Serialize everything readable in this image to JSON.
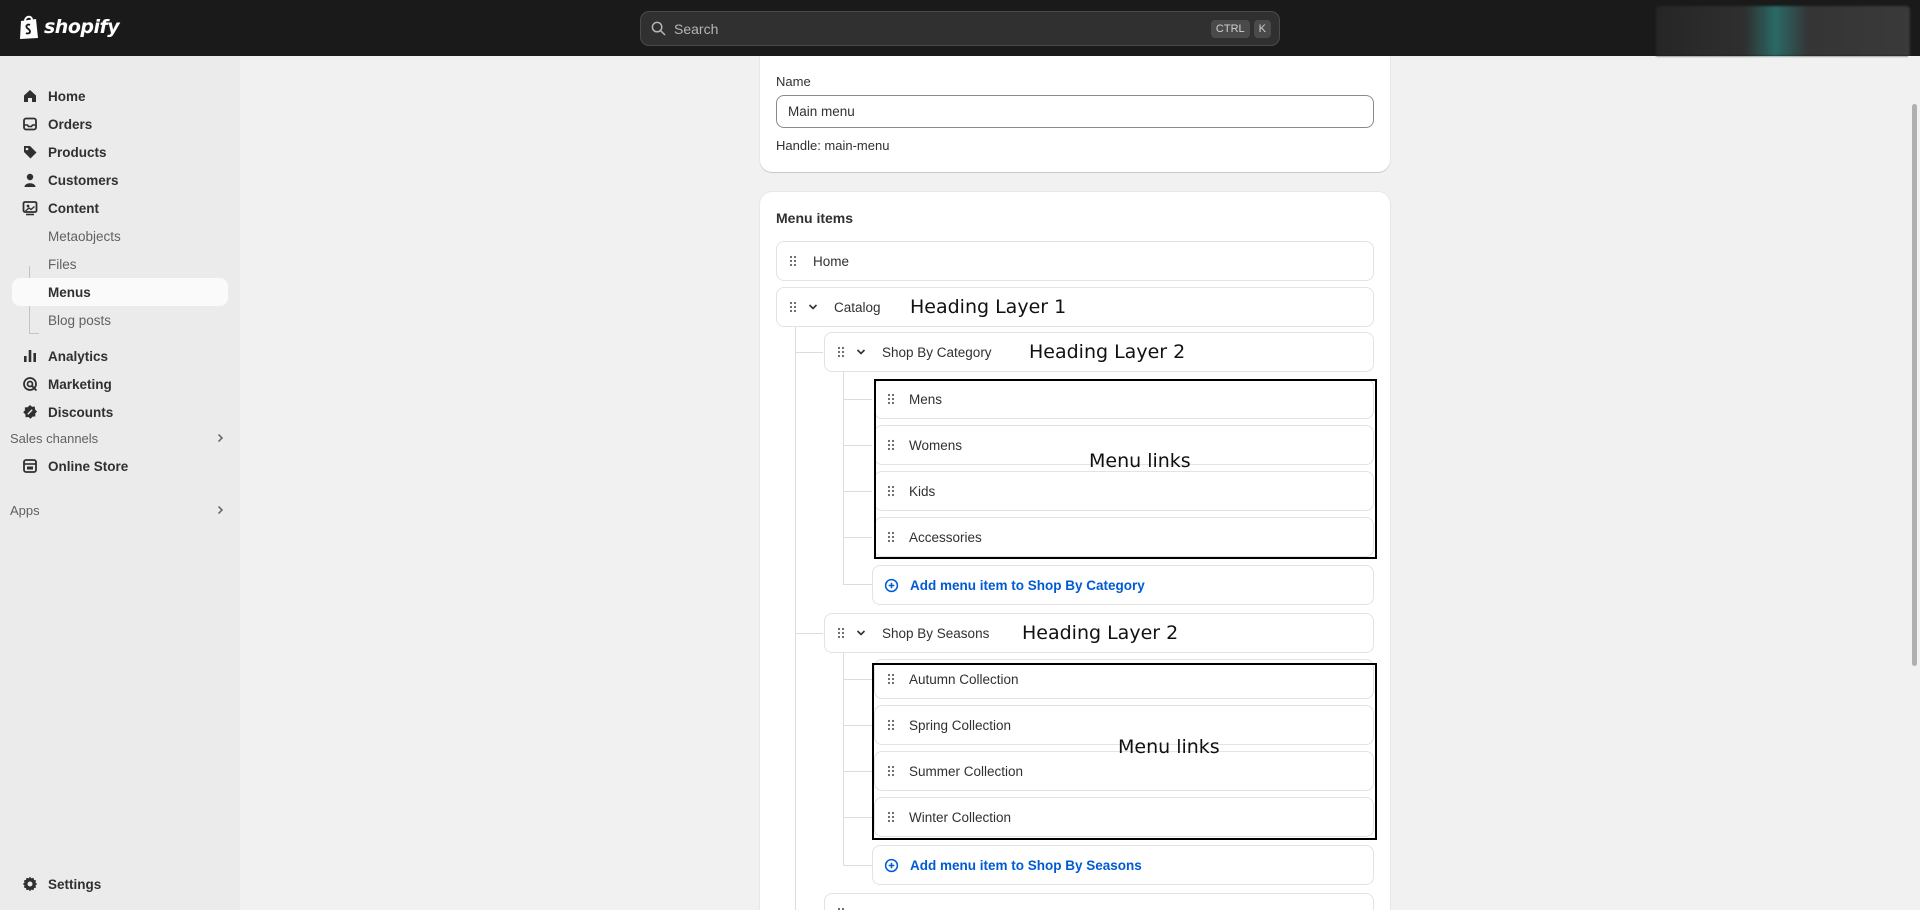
{
  "topbar": {
    "brand": "shopify",
    "search_placeholder": "Search",
    "shortcut_keys": [
      "CTRL",
      "K"
    ]
  },
  "sidebar": {
    "items": [
      {
        "label": "Home",
        "icon": "home-icon"
      },
      {
        "label": "Orders",
        "icon": "orders-icon"
      },
      {
        "label": "Products",
        "icon": "tag-icon"
      },
      {
        "label": "Customers",
        "icon": "person-icon"
      },
      {
        "label": "Content",
        "icon": "content-icon"
      }
    ],
    "content_sub": [
      {
        "label": "Metaobjects"
      },
      {
        "label": "Files"
      },
      {
        "label": "Menus",
        "active": true
      },
      {
        "label": "Blog posts"
      }
    ],
    "items2": [
      {
        "label": "Analytics",
        "icon": "bar-chart-icon"
      },
      {
        "label": "Marketing",
        "icon": "target-icon"
      },
      {
        "label": "Discounts",
        "icon": "discount-icon"
      }
    ],
    "sales_channels": {
      "label": "Sales channels",
      "items": [
        {
          "label": "Online Store",
          "icon": "store-icon"
        }
      ]
    },
    "apps": {
      "label": "Apps"
    },
    "settings": {
      "label": "Settings",
      "icon": "gear-icon"
    }
  },
  "name_card": {
    "name_label": "Name",
    "name_value": "Main menu",
    "handle": "Handle: main-menu"
  },
  "menu_items": {
    "title": "Menu items",
    "home": "Home",
    "catalog": "Catalog",
    "shop_by_category": "Shop By Category",
    "category_links": [
      "Mens",
      "Womens",
      "Kids",
      "Accessories"
    ],
    "add_to_category": "Add menu item to Shop By Category",
    "shop_by_seasons": "Shop By Seasons",
    "season_links": [
      "Autumn Collection",
      "Spring Collection",
      "Summer Collection",
      "Winter Collection"
    ],
    "add_to_seasons": "Add menu item to Shop By Seasons"
  },
  "annotations": {
    "heading_layer_1": "Heading Layer 1",
    "heading_layer_2a": "Heading Layer 2",
    "menu_links_a": "Menu links",
    "heading_layer_2b": "Heading Layer 2",
    "menu_links_b": "Menu links"
  },
  "colors": {
    "topbar": "#1a1a1a",
    "link_blue": "#005bd3",
    "sidebar_bg": "#ebebeb",
    "page_bg": "#f1f1f1"
  }
}
